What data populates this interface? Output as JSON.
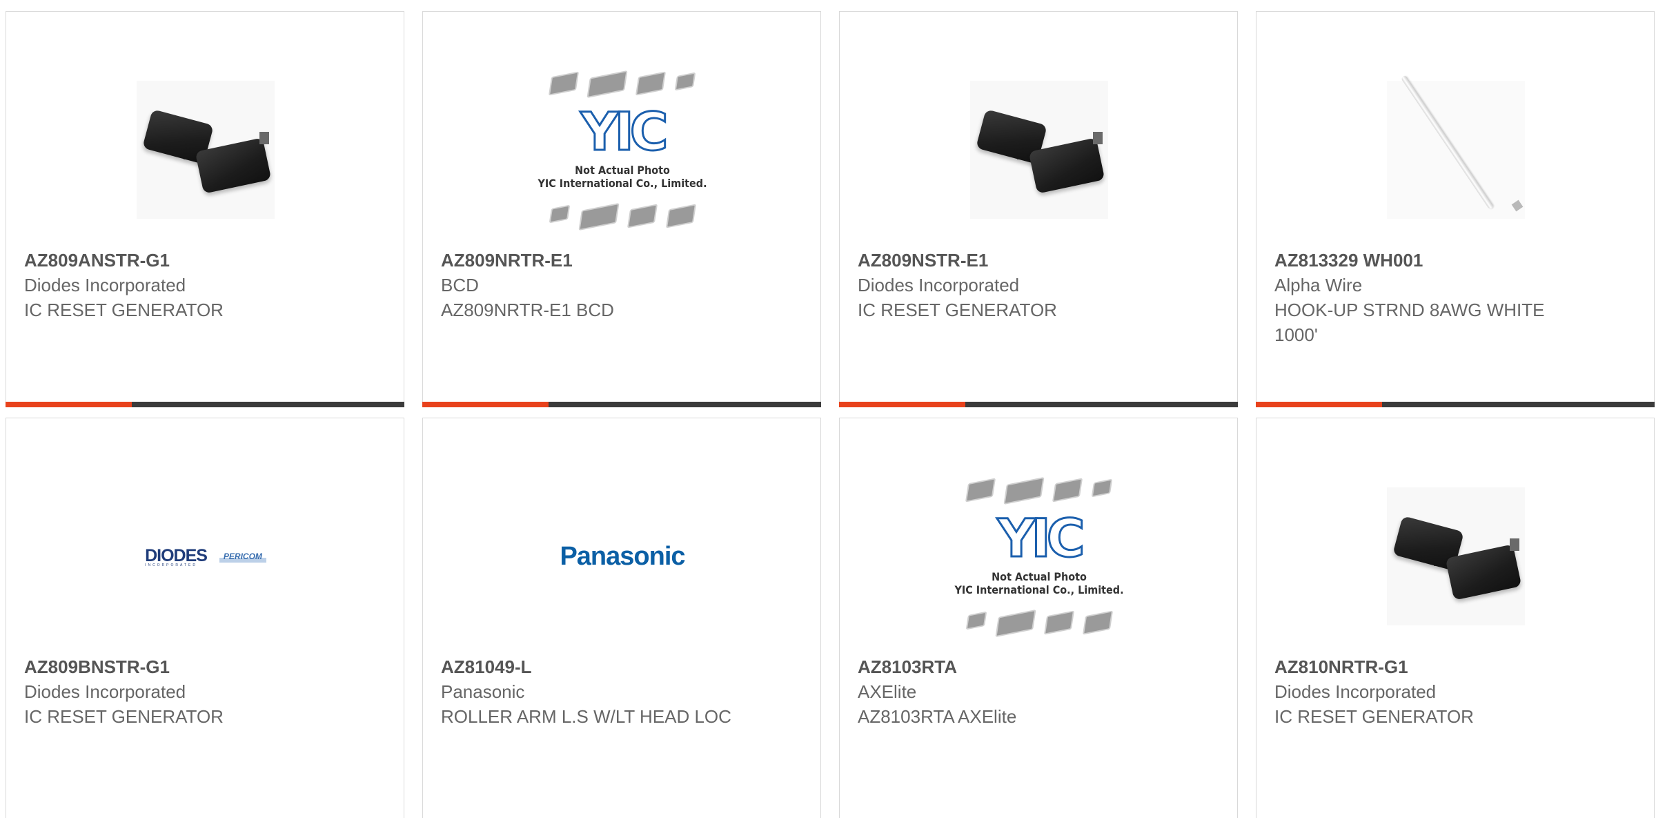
{
  "products": [
    {
      "part_number": "AZ809ANSTR-G1",
      "manufacturer": "Diodes Incorporated",
      "description": "IC RESET GENERATOR",
      "image": "sot23-chip-photo"
    },
    {
      "part_number": "AZ809NRTR-E1",
      "manufacturer": "BCD",
      "description": "AZ809NRTR-E1 BCD",
      "image": "yic-placeholder",
      "image_logo": "YIC",
      "image_caption_1": "Not Actual Photo",
      "image_caption_2": "YIC International Co., Limited."
    },
    {
      "part_number": "AZ809NSTR-E1",
      "manufacturer": "Diodes Incorporated",
      "description": "IC RESET GENERATOR",
      "image": "sot23-chip-photo"
    },
    {
      "part_number": "AZ813329 WH001",
      "manufacturer": "Alpha Wire",
      "description": "HOOK-UP STRND 8AWG WHITE 1000'",
      "image": "white-wire-photo"
    },
    {
      "part_number": "AZ809BNSTR-G1",
      "manufacturer": "Diodes Incorporated",
      "description": "IC RESET GENERATOR",
      "image": "diodes-pericom-logo",
      "image_logo": "DIODES",
      "image_logo_sub": "INCORPORATED",
      "image_logo_2": "PERICOM"
    },
    {
      "part_number": "AZ81049-L",
      "manufacturer": "Panasonic",
      "description": "ROLLER ARM L.S W/LT HEAD LOC",
      "image": "panasonic-logo",
      "image_logo": "Panasonic"
    },
    {
      "part_number": "AZ8103RTA",
      "manufacturer": "AXElite",
      "description": "AZ8103RTA AXElite",
      "image": "yic-placeholder",
      "image_logo": "YIC",
      "image_caption_1": "Not Actual Photo",
      "image_caption_2": "YIC International Co., Limited."
    },
    {
      "part_number": "AZ810NRTR-G1",
      "manufacturer": "Diodes Incorporated",
      "description": "IC RESET GENERATOR",
      "image": "sot23-chip-photo"
    }
  ],
  "colors": {
    "accent": "#e8421c",
    "bar": "#3b3b3b",
    "part_number_text": "#555555",
    "secondary_text": "#666666",
    "card_border": "#d9d9d9"
  }
}
